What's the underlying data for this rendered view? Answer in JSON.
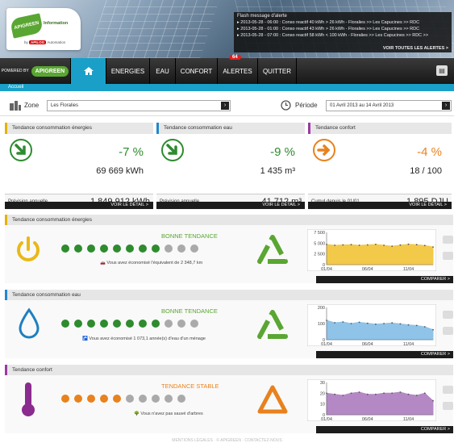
{
  "header": {
    "logo": {
      "brand": "APIGREEN",
      "tag": "Information",
      "by": "by",
      "partner": "APILOG",
      "partner_suffix": "Automation"
    },
    "flash": {
      "title": "Flash message d'alerte",
      "alerts": [
        "2013-05-28 - 06:00 : Conso reactif 40 kWh > 26 kWh - Floralies >> Les Capucines >> RDC",
        "2013-05-28 - 01:00 : Conso reactif 43 kWh > 26 kWh - Floralies >> Les Capucines >> RDC",
        "2013-05-28 - 07:00 : Conso reactif 58 kWh < 100 kWh - Floralies >> Les Capucines >> RDC >>"
      ],
      "see_all": "VOIR TOUTES LES ALERTES >"
    }
  },
  "nav": {
    "powered": "POWERED BY",
    "powered_brand": "APIGREEN",
    "home_icon": "home-icon",
    "items": [
      {
        "label": "ENERGIES"
      },
      {
        "label": "EAU"
      },
      {
        "label": "CONFORT"
      },
      {
        "label": "ALERTES",
        "badge": "64"
      },
      {
        "label": "QUITTER"
      }
    ],
    "print_icon": "printer-icon"
  },
  "breadcrumb": "Accueil",
  "filters": {
    "zone_label": "Zone",
    "zone_value": "Les Floralies",
    "period_label": "Période",
    "period_value": "01 Avril 2013 au 14 Avril 2013"
  },
  "cards": [
    {
      "title": "Tendance consommation énergies",
      "pct": "-7 %",
      "value": "69 669 kWh",
      "foot_label": "Prévision annuelle",
      "foot_value": "1 849 912 kWh",
      "detail": "VOIR LE DÉTAIL >",
      "color": "#e3b300",
      "icon": "arrow-down-right-icon"
    },
    {
      "title": "Tendance consommation eau",
      "pct": "-9 %",
      "value": "1 435 m³",
      "foot_label": "Prévision annuelle",
      "foot_value": "41 712 m³",
      "detail": "VOIR LE DÉTAIL >",
      "color": "#2288cc",
      "icon": "arrow-down-right-icon"
    },
    {
      "title": "Tendance confort",
      "pct": "-4 %",
      "value": "18 / 100",
      "foot_label": "Cumul depuis le 01/01",
      "foot_value": "1 895 DJU",
      "detail": "VOIR LE DÉTAIL >",
      "color": "#9a3aa2",
      "icon": "arrow-right-icon"
    }
  ],
  "sections": [
    {
      "title": "Tendance consommation énergies",
      "trend": "BONNE TENDANCE",
      "trend_color": "#5aa632",
      "note": "Vous avez économisé l'équivalent de 2 348,7 km",
      "compare": "COMPARER >",
      "icon": "power-icon",
      "dot_color": "#2e8b2e",
      "filled": 8,
      "total": 11,
      "chart_data": {
        "type": "area",
        "x": [
          "01/04",
          "06/04",
          "11/04"
        ],
        "yticks": [
          "7 500",
          "5 000",
          "2 500",
          "0"
        ],
        "values": [
          4700,
          4500,
          4600,
          4650,
          4500,
          4600,
          4700,
          4500,
          4300,
          4550,
          4750,
          4650,
          4450,
          4100
        ],
        "ylim": [
          0,
          7500
        ],
        "color": "#f3c94a"
      }
    },
    {
      "title": "Tendance consommation eau",
      "trend": "BONNE TENDANCE",
      "trend_color": "#5aa632",
      "note": "Vous avez économisé 1 073,1 année(s) d'eau d'un ménage",
      "compare": "COMPARER >",
      "icon": "water-drop-icon",
      "dot_color": "#2e8b2e",
      "filled": 8,
      "total": 11,
      "chart_data": {
        "type": "area",
        "x": [
          "01/04",
          "06/04",
          "11/04"
        ],
        "yticks": [
          "200",
          "100",
          "0"
        ],
        "values": [
          120,
          105,
          110,
          100,
          108,
          102,
          96,
          100,
          104,
          98,
          92,
          88,
          80,
          62
        ],
        "ylim": [
          0,
          200
        ],
        "color": "#8fc3e8"
      }
    },
    {
      "title": "Tendance confort",
      "trend": "TENDANCE STABLE",
      "trend_color": "#e8821e",
      "note": "Vous n'avez pas sauvé d'arbres",
      "compare": "COMPARER >",
      "icon": "thermometer-icon",
      "dot_color": "#e8821e",
      "filled": 5,
      "total": 10,
      "chart_data": {
        "type": "area",
        "x": [
          "01/04",
          "06/04",
          "11/04"
        ],
        "yticks": [
          "30",
          "20",
          "10",
          "0"
        ],
        "values": [
          20,
          19,
          18,
          20,
          21,
          19,
          19,
          20,
          20,
          21,
          19,
          18,
          20,
          13
        ],
        "ylim": [
          0,
          30
        ],
        "color": "#b388c4"
      }
    }
  ],
  "footer": "MENTIONS LÉGALES · © APIGREEN · CONTACTEZ-NOUS"
}
